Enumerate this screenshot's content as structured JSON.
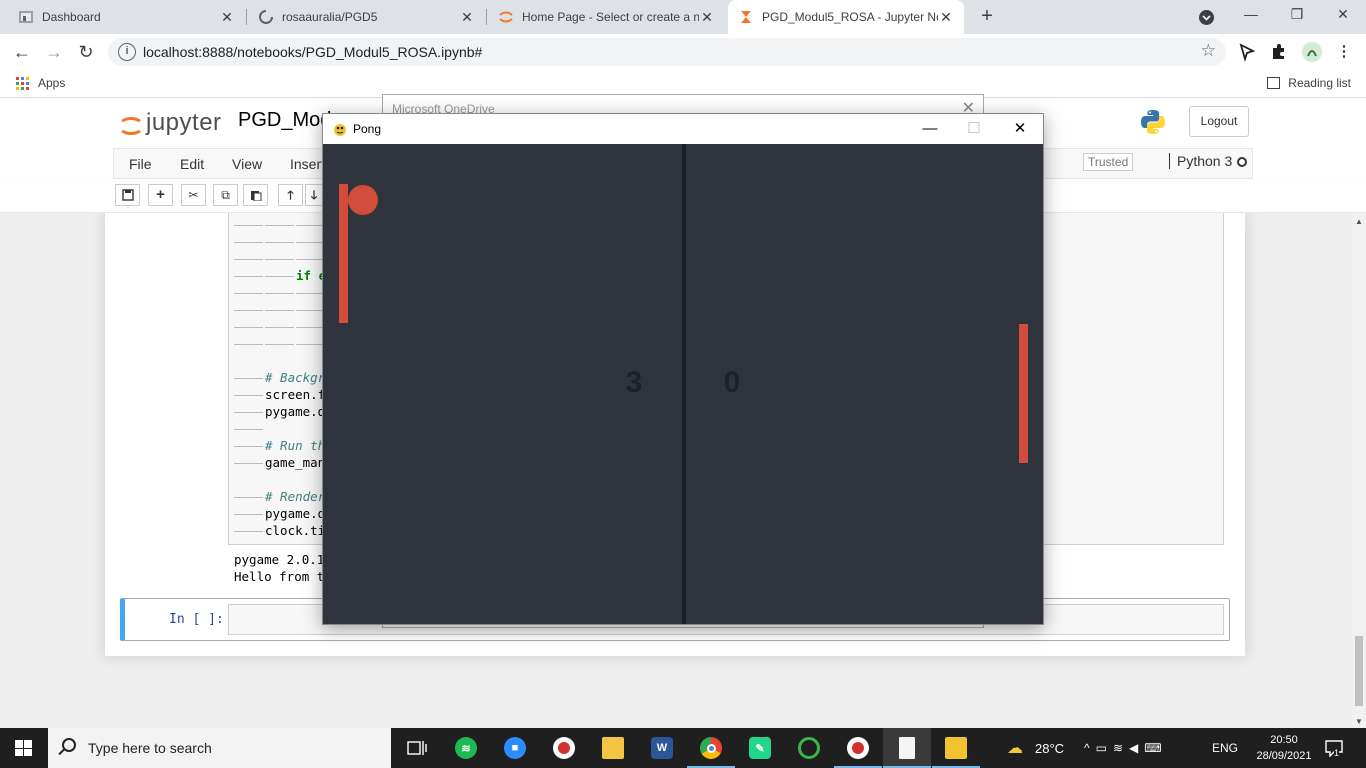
{
  "browser": {
    "tabs": [
      {
        "title": "Dashboard",
        "active": false
      },
      {
        "title": "rosaauralia/PGD5",
        "active": false
      },
      {
        "title": "Home Page - Select or create a n",
        "active": false
      },
      {
        "title": "PGD_Modul5_ROSA - Jupyter No",
        "active": true
      }
    ],
    "new_tab_label": "+",
    "url": "localhost:8888/notebooks/PGD_Modul5_ROSA.ipynb#",
    "bookmarks": {
      "apps_label": "Apps",
      "reading_list_label": "Reading list"
    },
    "colors": {
      "tabstrip": "#dee1e6",
      "active_tab": "#ffffff"
    }
  },
  "jupyter": {
    "logo_text": "jupyter",
    "notebook_name": "PGD_Mod",
    "logout_label": "Logout",
    "menu": [
      "File",
      "Edit",
      "View",
      "Insert"
    ],
    "trusted_label": "Trusted",
    "kernel_label": "Python 3",
    "toolbar_icons": [
      "save-icon",
      "plus-icon",
      "cut-icon",
      "copy-icon",
      "paste-icon",
      "arrow-up-icon",
      "arrow-down-icon"
    ],
    "code_lines": [
      {
        "text": "",
        "indent": 3
      },
      {
        "text": "",
        "indent": 3
      },
      {
        "text": "",
        "indent": 3
      },
      {
        "text": "if e",
        "indent": 2,
        "keyword": true
      },
      {
        "text": "",
        "indent": 3
      },
      {
        "text": "",
        "indent": 3
      },
      {
        "text": "",
        "indent": 3
      },
      {
        "text": "",
        "indent": 3
      },
      {
        "text": "",
        "indent": 0
      },
      {
        "text": "# Backgr",
        "indent": 1,
        "comment": true
      },
      {
        "text": "screen.f",
        "indent": 1
      },
      {
        "text": "pygame.d",
        "indent": 1
      },
      {
        "text": "",
        "indent": 1
      },
      {
        "text": "# Run th",
        "indent": 1,
        "comment": true
      },
      {
        "text": "game_man",
        "indent": 1
      },
      {
        "text": "",
        "indent": 0
      },
      {
        "text": "# Render",
        "indent": 1,
        "comment": true
      },
      {
        "text": "pygame.d",
        "indent": 1
      },
      {
        "text": "clock.ti",
        "indent": 1
      }
    ],
    "output_lines": [
      "pygame 2.0.1",
      "Hello from t"
    ],
    "empty_cell_prompt": "In [ ]:"
  },
  "onedrive": {
    "title": "Microsoft OneDrive"
  },
  "pong": {
    "window_title": "Pong",
    "score_left": "3",
    "score_right": "0",
    "colors": {
      "background": "#2f343c",
      "paddle": "#d24c3b",
      "ball": "#d24c3b",
      "net": "#1b1e22",
      "score": "#1e2228"
    }
  },
  "taskbar": {
    "search_placeholder": "Type here to search",
    "weather": "28°C",
    "language": "ENG",
    "time": "20:50",
    "date": "28/09/2021",
    "notifications_count": "1"
  }
}
